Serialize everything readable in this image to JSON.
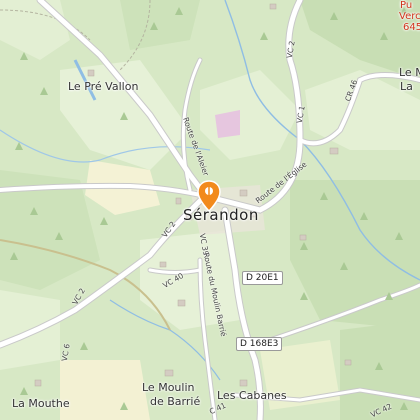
{
  "map": {
    "places": {
      "serandon": "Sérandon",
      "pre_vallon": "Le Pré Vallon",
      "moulin_line1": "Le Moulin",
      "moulin_line2": "de Barrié",
      "cabanes": "Les Cabanes",
      "mouthe": "La Mouthe",
      "le_m": "Le M",
      "la": "La",
      "pu": "Pu",
      "verc": "Verc",
      "elev": "645"
    },
    "roads": {
      "vc2_a": "VC 2",
      "vc2_b": "VC 2",
      "vc1": "VC 1",
      "vc2_top": "VC 2",
      "vc6": "VC 6",
      "vc40": "VC 40",
      "vc39": "VC 39",
      "c41": "C 41",
      "vc42": "VC 42",
      "cr46": "CR 46",
      "route_eglise": "Route de l'Église",
      "route_aleier": "Route de l'Aleier",
      "route_moulin": "Route du Moulin Barrié"
    },
    "shields": {
      "d20e1": "D 20E1",
      "d168e3": "D 168E3"
    },
    "marker_icon": "map-pin-icon"
  }
}
